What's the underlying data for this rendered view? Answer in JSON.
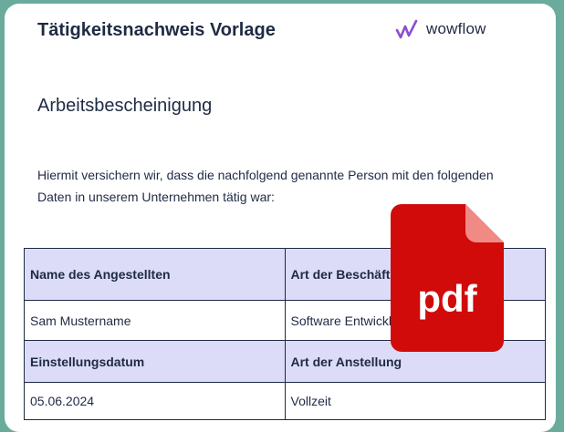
{
  "document": {
    "title": "Tätigkeitsnachweis Vorlage",
    "brand": "wowflow",
    "section_title": "Arbeitsbescheinigung",
    "intro": "Hiermit versichern wir, dass die nachfolgend genannte Person mit den folgenden Daten in unserem Unternehmen tätig war:"
  },
  "table": {
    "rows": [
      [
        "Name des Angestellten",
        "Art der Beschäftigung"
      ],
      [
        "Sam Mustername",
        "Software Entwickler"
      ],
      [
        "Einstellungsdatum",
        "Art der Anstellung"
      ],
      [
        "05.06.2024",
        "Vollzeit"
      ]
    ]
  },
  "pdf_badge": {
    "label": "pdf",
    "color": "#d10a0a",
    "fold_color": "#f08a85"
  },
  "colors": {
    "frame": "#6aab9c",
    "header_fill": "#dcdcf8",
    "brand_mark": "#8a4fd0"
  }
}
